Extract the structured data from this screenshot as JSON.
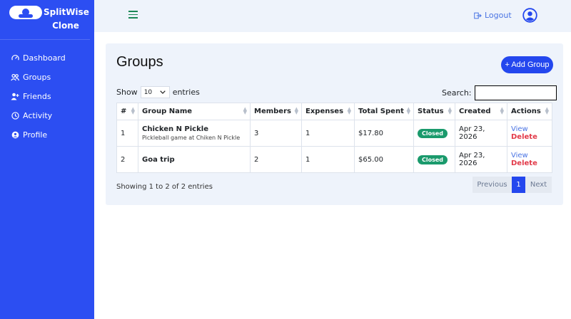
{
  "brand": {
    "name": "SplitWise Clone"
  },
  "sidebar": {
    "items": [
      {
        "label": "Dashboard",
        "icon": "gauge-icon"
      },
      {
        "label": "Groups",
        "icon": "users-icon"
      },
      {
        "label": "Friends",
        "icon": "user-plus-icon"
      },
      {
        "label": "Activity",
        "icon": "clock-icon"
      },
      {
        "label": "Profile",
        "icon": "user-circle-icon"
      }
    ]
  },
  "topbar": {
    "logout_label": "Logout"
  },
  "main": {
    "title": "Groups",
    "add_button": "+ Add Group",
    "show_label": "Show",
    "entries_value": "10",
    "entries_label": "entries",
    "search_label": "Search:",
    "search_value": "",
    "columns": [
      "#",
      "Group Name",
      "Members",
      "Expenses",
      "Total Spent",
      "Status",
      "Created",
      "Actions"
    ],
    "rows": [
      {
        "num": "1",
        "name": "Chicken N Pickle",
        "desc": "Pickleball game at Chiken N Pickle",
        "members": "3",
        "expenses": "1",
        "total": "$17.80",
        "status": "Closed",
        "created": "Apr 23, 2026",
        "view": "View",
        "delete": "Delete"
      },
      {
        "num": "2",
        "name": "Goa trip",
        "desc": "",
        "members": "2",
        "expenses": "1",
        "total": "$65.00",
        "status": "Closed",
        "created": "Apr 23, 2026",
        "view": "View",
        "delete": "Delete"
      }
    ],
    "info": "Showing 1 to 2 of 2 entries",
    "pagination": {
      "prev": "Previous",
      "current": "1",
      "next": "Next"
    }
  },
  "colors": {
    "sidebar": "#2c4ef2",
    "accent": "#2447ee",
    "status_closed": "#1a9a6c",
    "delete": "#e23b4a"
  }
}
